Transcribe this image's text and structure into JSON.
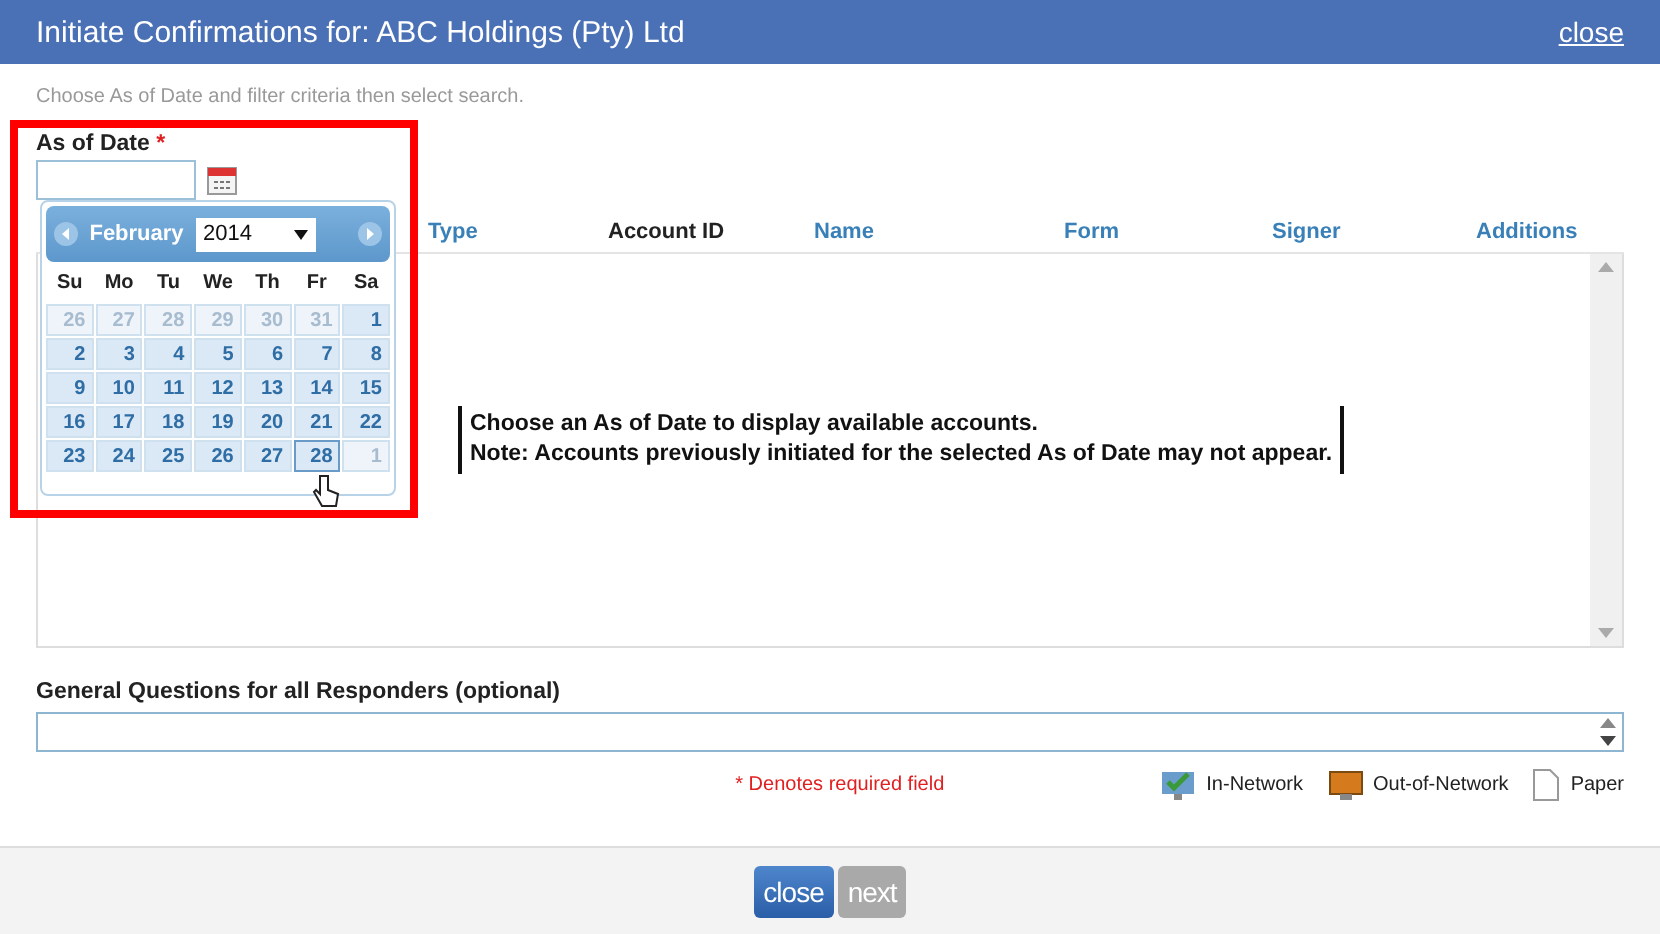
{
  "window": {
    "title": "Initiate Confirmations for: ABC Holdings (Pty) Ltd",
    "close": "close"
  },
  "hint": "Choose As of Date and filter criteria then select search.",
  "as_of_date": {
    "label": "As of Date",
    "required_mark": "*"
  },
  "calendar": {
    "month": "February",
    "year": "2014",
    "weekdays": [
      "Su",
      "Mo",
      "Tu",
      "We",
      "Th",
      "Fr",
      "Sa"
    ],
    "days": [
      {
        "label": "26",
        "other_month": true,
        "selected": false
      },
      {
        "label": "27",
        "other_month": true,
        "selected": false
      },
      {
        "label": "28",
        "other_month": true,
        "selected": false
      },
      {
        "label": "29",
        "other_month": true,
        "selected": false
      },
      {
        "label": "30",
        "other_month": true,
        "selected": false
      },
      {
        "label": "31",
        "other_month": true,
        "selected": false
      },
      {
        "label": "1",
        "other_month": false,
        "selected": false
      },
      {
        "label": "2",
        "other_month": false,
        "selected": false
      },
      {
        "label": "3",
        "other_month": false,
        "selected": false
      },
      {
        "label": "4",
        "other_month": false,
        "selected": false
      },
      {
        "label": "5",
        "other_month": false,
        "selected": false
      },
      {
        "label": "6",
        "other_month": false,
        "selected": false
      },
      {
        "label": "7",
        "other_month": false,
        "selected": false
      },
      {
        "label": "8",
        "other_month": false,
        "selected": false
      },
      {
        "label": "9",
        "other_month": false,
        "selected": false
      },
      {
        "label": "10",
        "other_month": false,
        "selected": false
      },
      {
        "label": "11",
        "other_month": false,
        "selected": false
      },
      {
        "label": "12",
        "other_month": false,
        "selected": false
      },
      {
        "label": "13",
        "other_month": false,
        "selected": false
      },
      {
        "label": "14",
        "other_month": false,
        "selected": false
      },
      {
        "label": "15",
        "other_month": false,
        "selected": false
      },
      {
        "label": "16",
        "other_month": false,
        "selected": false
      },
      {
        "label": "17",
        "other_month": false,
        "selected": false
      },
      {
        "label": "18",
        "other_month": false,
        "selected": false
      },
      {
        "label": "19",
        "other_month": false,
        "selected": false
      },
      {
        "label": "20",
        "other_month": false,
        "selected": false
      },
      {
        "label": "21",
        "other_month": false,
        "selected": false
      },
      {
        "label": "22",
        "other_month": false,
        "selected": false
      },
      {
        "label": "23",
        "other_month": false,
        "selected": false
      },
      {
        "label": "24",
        "other_month": false,
        "selected": false
      },
      {
        "label": "25",
        "other_month": false,
        "selected": false
      },
      {
        "label": "26",
        "other_month": false,
        "selected": false
      },
      {
        "label": "27",
        "other_month": false,
        "selected": false
      },
      {
        "label": "28",
        "other_month": false,
        "selected": true
      },
      {
        "label": "1",
        "other_month": true,
        "selected": false
      }
    ]
  },
  "table": {
    "columns": [
      {
        "label": "Type",
        "selected": false
      },
      {
        "label": "Account ID",
        "selected": true
      },
      {
        "label": "Name",
        "selected": false
      },
      {
        "label": "Form",
        "selected": false
      },
      {
        "label": "Signer",
        "selected": false
      },
      {
        "label": "Additions",
        "selected": false
      }
    ],
    "empty_message": [
      "Choose an As of Date to display available accounts.",
      "Note: Accounts previously initiated for the selected As of Date may not appear."
    ]
  },
  "general_questions": {
    "label": "General Questions for all Responders (optional)"
  },
  "required_note": "* Denotes required field",
  "legend": [
    {
      "kind": "in-network",
      "label": "In-Network"
    },
    {
      "kind": "out-of-network",
      "label": "Out-of-Network"
    },
    {
      "kind": "paper",
      "label": "Paper"
    }
  ],
  "buttons": [
    {
      "label": "close",
      "disabled": false
    },
    {
      "label": "next",
      "disabled": true
    }
  ]
}
